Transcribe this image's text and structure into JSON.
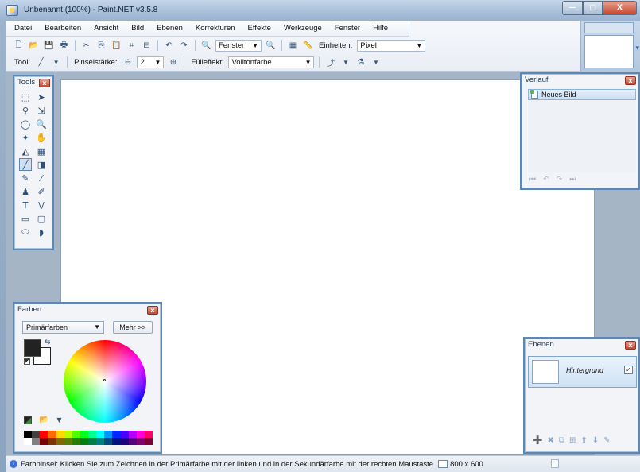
{
  "window": {
    "title": "Unbenannt (100%) - Paint.NET v3.5.8",
    "controls": {
      "minimize": "—",
      "maximize": "□",
      "close": "X"
    }
  },
  "menu": [
    "Datei",
    "Bearbeiten",
    "Ansicht",
    "Bild",
    "Ebenen",
    "Korrekturen",
    "Effekte",
    "Werkzeuge",
    "Fenster",
    "Hilfe"
  ],
  "toolbar1": {
    "zoom_select": "Fenster",
    "units_label": "Einheiten:",
    "units_select": "Pixel",
    "icons": [
      "new-icon",
      "open-icon",
      "save-icon",
      "print-icon",
      "cut-icon",
      "copy-icon",
      "paste-icon",
      "crop-icon",
      "deselect-icon",
      "undo-icon",
      "redo-icon",
      "zoom-out-icon",
      "zoom-in-icon",
      "grid-icon",
      "ruler-icon"
    ]
  },
  "toolbar2": {
    "tool_label": "Tool:",
    "brush_width_label": "Pinselstärke:",
    "brush_width_value": "2",
    "fill_label": "Fülleffekt:",
    "fill_value": "Volltonfarbe"
  },
  "tools_panel": {
    "title": "Tools",
    "close": "x",
    "tools": [
      {
        "name": "rectangle-select-tool",
        "glyph": "⬚"
      },
      {
        "name": "move-selected-pixels-tool",
        "glyph": "➤"
      },
      {
        "name": "lasso-select-tool",
        "glyph": "⚲"
      },
      {
        "name": "move-selection-tool",
        "glyph": "⇲"
      },
      {
        "name": "ellipse-select-tool",
        "glyph": "◯"
      },
      {
        "name": "zoom-tool",
        "glyph": "🔍"
      },
      {
        "name": "magic-wand-tool",
        "glyph": "✦"
      },
      {
        "name": "pan-tool",
        "glyph": "✋"
      },
      {
        "name": "paint-bucket-tool",
        "glyph": "◭"
      },
      {
        "name": "gradient-tool",
        "glyph": "▦"
      },
      {
        "name": "paintbrush-tool",
        "glyph": "╱"
      },
      {
        "name": "eraser-tool",
        "glyph": "◨"
      },
      {
        "name": "pencil-tool",
        "glyph": "✎"
      },
      {
        "name": "color-picker-tool",
        "glyph": "⁄"
      },
      {
        "name": "clone-stamp-tool",
        "glyph": "♟"
      },
      {
        "name": "recolor-tool",
        "glyph": "✐"
      },
      {
        "name": "text-tool",
        "glyph": "T"
      },
      {
        "name": "line-curve-tool",
        "glyph": "\\/"
      },
      {
        "name": "rectangle-tool",
        "glyph": "▭"
      },
      {
        "name": "rounded-rectangle-tool",
        "glyph": "▢"
      },
      {
        "name": "ellipse-tool",
        "glyph": "⬭"
      },
      {
        "name": "freeform-shape-tool",
        "glyph": "◗"
      }
    ],
    "active_tool": "paintbrush-tool"
  },
  "colors_panel": {
    "title": "Farben",
    "close": "x",
    "mode_select": "Primärfarben",
    "more_button": "Mehr >>",
    "primary_color": "#222222",
    "secondary_color": "#ffffff",
    "palette_row1": [
      "#000000",
      "#404040",
      "#ff0000",
      "#ff6a00",
      "#ffd800",
      "#b6ff00",
      "#4cff00",
      "#00ff21",
      "#00ff90",
      "#00ffff",
      "#0094ff",
      "#0026ff",
      "#4800ff",
      "#b200ff",
      "#ff00dc",
      "#ff006e"
    ],
    "palette_row2": [
      "#ffffff",
      "#808080",
      "#7f0000",
      "#7f3300",
      "#7f6a00",
      "#5b7f00",
      "#267f00",
      "#007f0e",
      "#007f46",
      "#007f7f",
      "#004a7f",
      "#00137f",
      "#21007f",
      "#57007f",
      "#7f006e",
      "#7f0037"
    ]
  },
  "history_panel": {
    "title": "Verlauf",
    "close": "x",
    "items": [
      "Neues Bild"
    ],
    "controls": [
      "⏮",
      "↶",
      "↷",
      "⏭"
    ]
  },
  "layers_panel": {
    "title": "Ebenen",
    "close": "x",
    "layers": [
      {
        "name": "Hintergrund",
        "visible": "✓"
      }
    ],
    "controls": [
      "add-layer-icon",
      "delete-layer-icon",
      "duplicate-layer-icon",
      "merge-layer-icon",
      "move-up-icon",
      "move-down-icon",
      "layer-properties-icon"
    ]
  },
  "status": {
    "text": "Farbpinsel: Klicken Sie zum Zeichnen in der Primärfarbe mit der linken und in der Sekundärfarbe mit der rechten Maustaste",
    "image_size": "800 x 600"
  }
}
